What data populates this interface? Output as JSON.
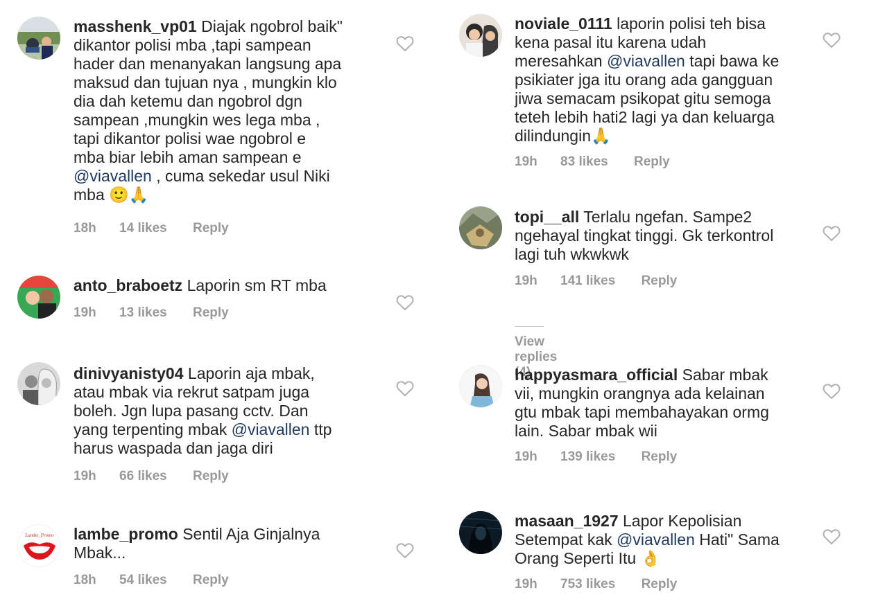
{
  "left": [
    {
      "username": "masshenk_vp01",
      "lines": [
        [
          {
            "t": " Diajak ngobrol baik\""
          }
        ],
        [
          {
            "t": "dikantor polisi mba ,tapi sampean"
          }
        ],
        [
          {
            "t": "hader dan menanyakan langsung apa"
          }
        ],
        [
          {
            "t": "maksud dan tujuan nya , mungkin klo"
          }
        ],
        [
          {
            "t": "dia dah ketemu dan ngobrol dgn"
          }
        ],
        [
          {
            "t": "sampean ,mungkin wes lega mba ,"
          }
        ],
        [
          {
            "t": "tapi dikantor polisi wae ngobrol e"
          }
        ],
        [
          {
            "t": "mba biar lebih aman sampean e"
          }
        ],
        [
          {
            "t": "@viavallen",
            "m": true
          },
          {
            "t": " , cuma sekedar usul Niki"
          }
        ],
        [
          {
            "t": "mba 🙂🙏"
          }
        ]
      ],
      "time": "18h",
      "likes": "14 likes",
      "reply": "Reply"
    },
    {
      "username": "anto_braboetz",
      "lines": [
        [
          {
            "t": " Laporin sm RT mba"
          }
        ]
      ],
      "time": "19h",
      "likes": "13 likes",
      "reply": "Reply"
    },
    {
      "username": "dinivyanisty04",
      "lines": [
        [
          {
            "t": " Laporin aja mbak,"
          }
        ],
        [
          {
            "t": "atau mbak via rekrut satpam juga"
          }
        ],
        [
          {
            "t": "boleh. Jgn lupa pasang cctv. Dan"
          }
        ],
        [
          {
            "t": "yang terpenting mbak "
          },
          {
            "t": "@viavallen",
            "m": true
          },
          {
            "t": " ttp"
          }
        ],
        [
          {
            "t": "harus waspada dan jaga diri"
          }
        ]
      ],
      "time": "19h",
      "likes": "66 likes",
      "reply": "Reply"
    },
    {
      "username": "lambe_promo",
      "lines": [
        [
          {
            "t": " Sentil Aja Ginjalnya"
          }
        ],
        [
          {
            "t": "Mbak..."
          }
        ]
      ],
      "time": "18h",
      "likes": "54 likes",
      "reply": "Reply",
      "avatar_text": "Lambe_Promo"
    }
  ],
  "right": [
    {
      "username": "noviale_0111",
      "lines": [
        [
          {
            "t": " laporin polisi teh bisa"
          }
        ],
        [
          {
            "t": "kena pasal itu karena udah"
          }
        ],
        [
          {
            "t": "meresahkan "
          },
          {
            "t": "@viavallen",
            "m": true
          },
          {
            "t": " tapi bawa ke"
          }
        ],
        [
          {
            "t": "psikiater jga itu orang ada gangguan"
          }
        ],
        [
          {
            "t": "jiwa semacam psikopat gitu semoga"
          }
        ],
        [
          {
            "t": "teteh lebih hati2 lagi ya dan keluarga"
          }
        ],
        [
          {
            "t": "dilindungin🙏"
          }
        ]
      ],
      "time": "19h",
      "likes": "83 likes",
      "reply": "Reply"
    },
    {
      "username": "topi__all",
      "lines": [
        [
          {
            "t": " Terlalu ngefan. Sampe2"
          }
        ],
        [
          {
            "t": "ngehayal tingkat tinggi. Gk terkontrol"
          }
        ],
        [
          {
            "t": "lagi tuh wkwkwk"
          }
        ]
      ],
      "time": "19h",
      "likes": "141 likes",
      "reply": "Reply",
      "view_replies": "View replies (4)"
    },
    {
      "username": "happyasmara_official",
      "lines": [
        [
          {
            "t": " Sabar mbak"
          }
        ],
        [
          {
            "t": "vii, mungkin orangnya ada kelainan"
          }
        ],
        [
          {
            "t": "gtu mbak tapi membahayakan ormg"
          }
        ],
        [
          {
            "t": "lain. Sabar mbak wii"
          }
        ]
      ],
      "time": "19h",
      "likes": "139 likes",
      "reply": "Reply"
    },
    {
      "username": "masaan_1927",
      "lines": [
        [
          {
            "t": " Lapor Kepolisian"
          }
        ],
        [
          {
            "t": "Setempat kak "
          },
          {
            "t": "@viavallen",
            "m": true
          },
          {
            "t": " Hati\" Sama"
          }
        ],
        [
          {
            "t": "Orang Seperti Itu 👌"
          }
        ]
      ],
      "time": "19h",
      "likes": "753 likes",
      "reply": "Reply"
    }
  ],
  "colors": {
    "mention": "#1e3a5f",
    "meta": "#999999",
    "text": "#262626",
    "heart": "#b0b0b0"
  }
}
